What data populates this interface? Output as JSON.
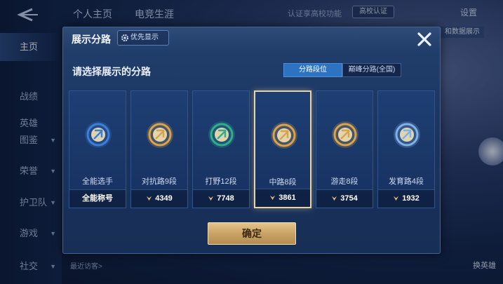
{
  "background": {
    "top_tabs": [
      "个人主页",
      "电竞生涯"
    ],
    "top_right": {
      "cert_button_text": "认证享高校功能",
      "badge": "高校认证",
      "settings": "设置"
    },
    "right_chip": "和数据展示",
    "nav": [
      {
        "label": "主页",
        "active": true,
        "chevron": false
      },
      {
        "label": "战绩",
        "active": false,
        "chevron": false
      },
      {
        "label": "英雄",
        "active": false,
        "chevron": false
      },
      {
        "label": "图鉴",
        "active": false,
        "chevron": true
      },
      {
        "label": "荣誉",
        "active": false,
        "chevron": true
      },
      {
        "label": "护卫队",
        "active": false,
        "chevron": true
      },
      {
        "label": "游戏",
        "active": false,
        "chevron": true
      },
      {
        "label": "社交",
        "active": false,
        "chevron": true
      }
    ],
    "recent_visitors": "最近访客>",
    "swap_hero": "换英雄"
  },
  "modal": {
    "title": "展示分路",
    "priority_button": "优先显示",
    "prompt": "请选择展示的分路",
    "segments": [
      {
        "label": "分路段位",
        "active": true
      },
      {
        "label": "巅峰分路(全国)",
        "active": false
      }
    ],
    "cards": [
      {
        "label": "全能选手",
        "footer": "全能称号",
        "has_points_icon": false,
        "emblem_color": "#3b7fd9",
        "selected": false
      },
      {
        "label": "对抗路9段",
        "footer": "4349",
        "has_points_icon": true,
        "emblem_color": "#d8a34a",
        "selected": false
      },
      {
        "label": "打野12段",
        "footer": "7748",
        "has_points_icon": true,
        "emblem_color": "#2fae8c",
        "selected": false
      },
      {
        "label": "中路8段",
        "footer": "3861",
        "has_points_icon": true,
        "emblem_color": "#d8a34a",
        "selected": true
      },
      {
        "label": "游走8段",
        "footer": "3754",
        "has_points_icon": true,
        "emblem_color": "#d8a34a",
        "selected": false
      },
      {
        "label": "发育路4段",
        "footer": "1932",
        "has_points_icon": true,
        "emblem_color": "#7fb0e6",
        "selected": false
      }
    ],
    "confirm": "确定"
  },
  "colors": {
    "accent_gold": "#e6c58a",
    "segment_active": "#2e73c2",
    "modal_bg": "#1b3560"
  }
}
